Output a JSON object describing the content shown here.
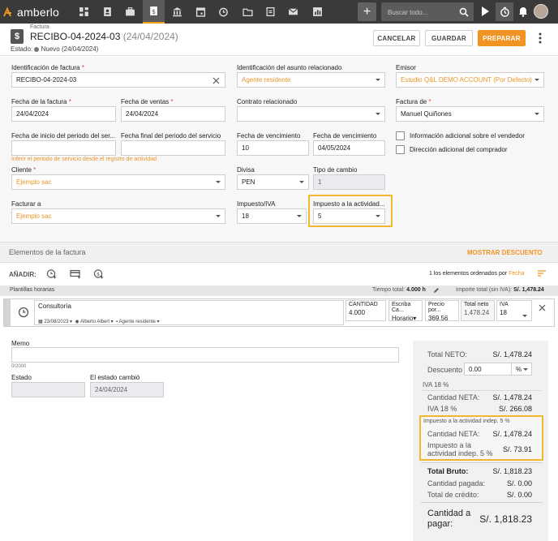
{
  "nav": {
    "logo_text": "amberlo",
    "icons": [
      "dashboard-icon",
      "contacts-icon",
      "briefcase-icon",
      "invoice-icon",
      "bank-icon",
      "calendar-icon",
      "timer-icon",
      "folder-icon",
      "document-icon",
      "mail-icon",
      "reports-icon"
    ],
    "search_placeholder": "Buscar todo..."
  },
  "header": {
    "type_label": "Factura",
    "title": "RECIBO-04-2024-03",
    "title_date": "(24/04/2024)",
    "status_prefix": "Estado:",
    "status_text": "Nuevo (24/04/2024)",
    "cancel_label": "CANCELAR",
    "save_label": "GUARDAR",
    "prepare_label": "PREPARAR"
  },
  "form": {
    "invoice_id_label": "Identificación de factura",
    "invoice_id_value": "RECIBO-04-2024-03",
    "matter_label": "Identificación del asunto relacionado",
    "matter_value": "Agente residente",
    "issuer_label": "Emisor",
    "issuer_value": "Estudio Q&L DEMO ACCOUNT (Por Defecto)",
    "invoice_date_label": "Fecha de la factura",
    "invoice_date_value": "24/04/2024",
    "sales_date_label": "Fecha de ventas",
    "sales_date_value": "24/04/2024",
    "contract_label": "Contrato relacionado",
    "contract_value": "",
    "invoice_of_label": "Factura de",
    "invoice_of_value": "Manuel Quiñones",
    "period_start_label": "Fecha de inicio del periodo del ser...",
    "period_end_label": "Fecha final del periodo del servicio",
    "period_hint": "Inferir el periodo de servicio desde el registro de actividad",
    "due_days_label": "Fecha de vencimiento",
    "due_days_value": "10",
    "due_date_label": "Fecha de vencimiento",
    "due_date_value": "04/05/2024",
    "seller_info_label": "Información adicional sobre el vendedor",
    "buyer_address_label": "Dirección adicional del comprador",
    "client_label": "Cliente",
    "client_value": "Ejemplo sac",
    "currency_label": "Divisa",
    "currency_value": "PEN",
    "rate_label": "Tipo de cambio",
    "rate_value": "1",
    "bill_to_label": "Facturar a",
    "bill_to_value": "Ejemplo sac",
    "tax_label": "Impuesto/IVA",
    "tax_value": "18",
    "activity_tax_label": "Impuesto a la actividad...",
    "activity_tax_value": "5"
  },
  "elements": {
    "section_title": "Elementos de la factura",
    "show_discount": "MOSTRAR DESCUENTO",
    "add_label": "AÑADIR:",
    "sort_text": "1 los elementos ordenados por",
    "sort_field": "Fecha",
    "templates_label": "Plantillas horarias",
    "total_time_label": "Tiempo total:",
    "total_time_value": "4.000 h",
    "total_amount_label": "Importe total (sin IVA):",
    "total_amount_value": "S/. 1,478.24",
    "item": {
      "name": "Consultoría",
      "date": "23/08/2023",
      "user": "Alberto Albert",
      "matter": "Agente residente",
      "qty_label": "CANTIDAD",
      "qty_value": "4.000",
      "unit_label": "Escriba Ca...",
      "unit_value": "Horario",
      "price_label": "Precio por...",
      "price_value": "369.56",
      "net_label": "Total neto",
      "net_value": "1,478.24",
      "vat_label": "IVA",
      "vat_value": "18"
    }
  },
  "bottom": {
    "memo_label": "Memo",
    "memo_counter": "0/2000",
    "status_label": "Estado",
    "status_changed_label": "El estado cambió",
    "status_changed_value": "24/04/2024"
  },
  "totals": {
    "net_label": "Total NETO:",
    "net_value": "S/. 1,478.24",
    "discount_label": "Descuento",
    "discount_value": "0.00",
    "discount_unit": "%",
    "vat_group": "IVA 18 %",
    "vat_net_label": "Cantidad NETA:",
    "vat_net_value": "S/. 1,478.24",
    "vat_label": "IVA 18 %",
    "vat_value": "S/. 266.08",
    "act_group": "Impuesto a la actividad indep. 5 %",
    "act_net_label": "Cantidad NETA:",
    "act_net_value": "S/. 1,478.24",
    "act_label": "Impuesto a la actividad indep. 5 %",
    "act_value": "S/. 73.91",
    "gross_label": "Total Bruto:",
    "gross_value": "S/. 1,818.23",
    "paid_label": "Cantidad pagada:",
    "paid_value": "S/. 0.00",
    "credit_label": "Total de crédito:",
    "credit_value": "S/. 0.00",
    "pay_label": "Cantidad a pagar:",
    "pay_value": "S/. 1,818.23"
  },
  "colors": {
    "accent": "#f29423",
    "highlight": "#f0b82d",
    "nav": "#3a3a3a"
  }
}
